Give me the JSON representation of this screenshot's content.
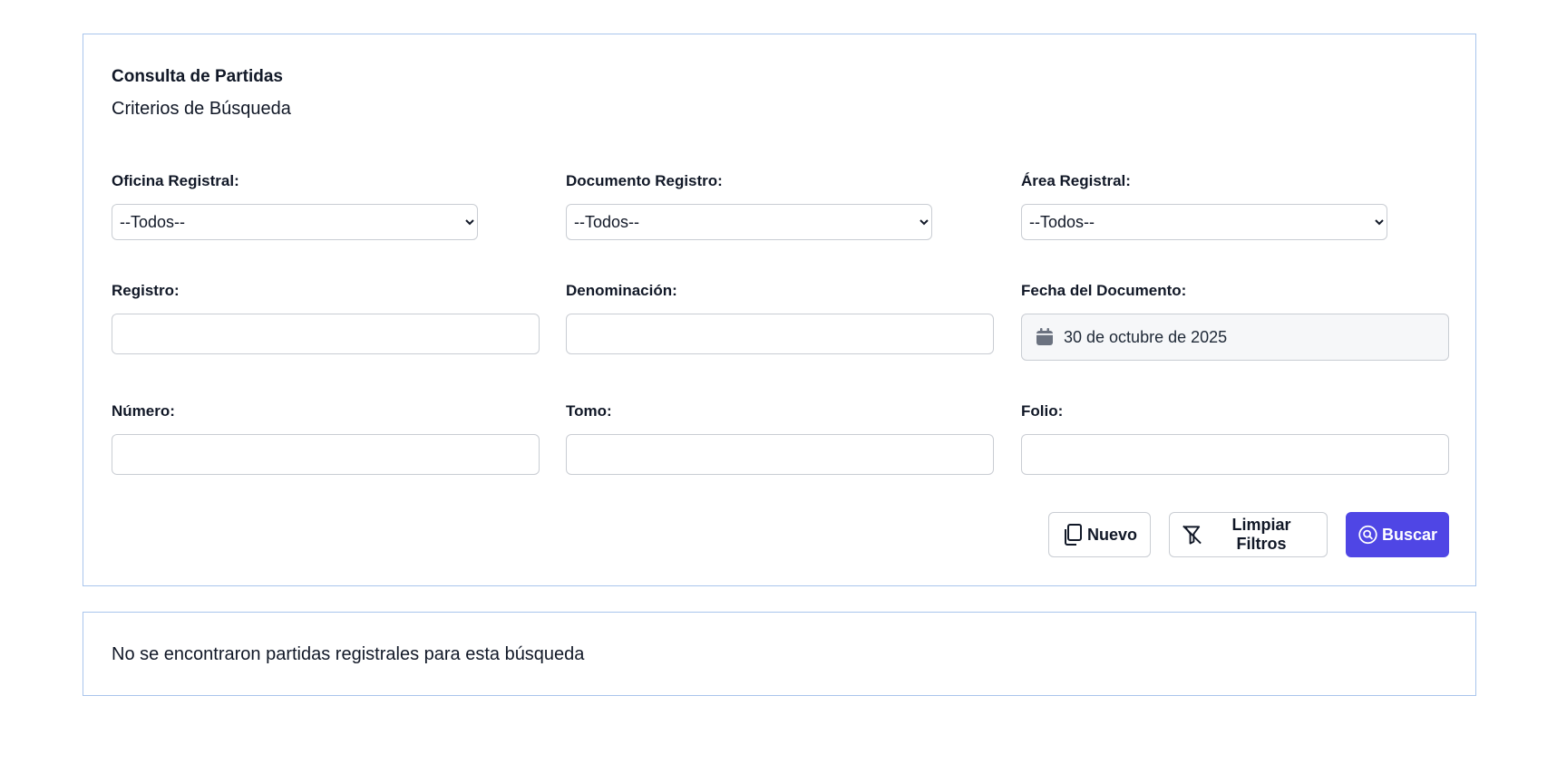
{
  "header": {
    "title": "Consulta de Partidas",
    "subtitle": "Criterios de Búsqueda"
  },
  "filters": {
    "oficina": {
      "label": "Oficina Registral:",
      "selected": "--Todos--"
    },
    "documento": {
      "label": "Documento Registro:",
      "selected": "--Todos--"
    },
    "area": {
      "label": "Área Registral:",
      "selected": "--Todos--"
    },
    "registro": {
      "label": "Registro:",
      "value": ""
    },
    "denominacion": {
      "label": "Denominación:",
      "value": ""
    },
    "fecha": {
      "label": "Fecha del Documento:",
      "value": "30 de octubre de 2025",
      "icon": "calendar-icon"
    },
    "numero": {
      "label": "Número:",
      "value": ""
    },
    "tomo": {
      "label": "Tomo:",
      "value": ""
    },
    "folio": {
      "label": "Folio:",
      "value": ""
    }
  },
  "actions": {
    "nuevo": {
      "label": "Nuevo",
      "icon": "copy-icon"
    },
    "limpiar": {
      "label": "Limpiar Filtros",
      "icon": "filter-off-icon"
    },
    "buscar": {
      "label": "Buscar",
      "icon": "search-circle-icon"
    }
  },
  "results": {
    "empty_message": "No se encontraron partidas registrales para esta búsqueda"
  },
  "colors": {
    "primary": "#4f46e5",
    "panel_border": "#a9c5ec"
  }
}
